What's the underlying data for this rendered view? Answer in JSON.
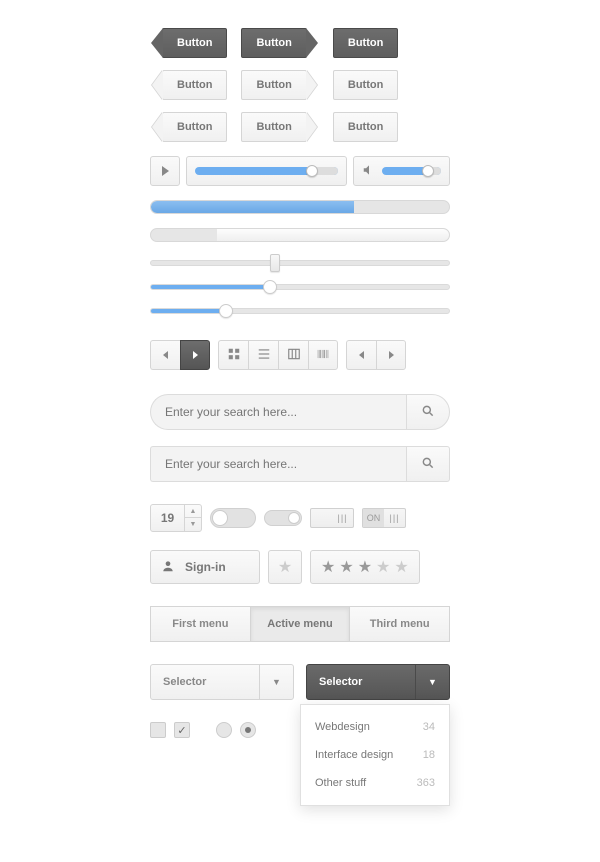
{
  "buttons": {
    "row1": [
      "Button",
      "Button",
      "Button"
    ],
    "row2": [
      "Button",
      "Button",
      "Button"
    ],
    "row3": [
      "Button",
      "Button",
      "Button"
    ]
  },
  "player": {
    "progress_pct": 82,
    "volume_pct": 78
  },
  "progress": {
    "blue_pct": 68,
    "gray_pct": 22
  },
  "sliders": {
    "s1_pct": 40,
    "s2_pct": 40,
    "s3_pct": 25
  },
  "search": {
    "placeholder": "Enter your search here..."
  },
  "stepper": {
    "value": "19"
  },
  "toggle_rect": {
    "on_label": "ON"
  },
  "signin": {
    "label": "Sign-in"
  },
  "rating": {
    "value": 3,
    "max": 5
  },
  "tabs": [
    "First menu",
    "Active menu",
    "Third menu"
  ],
  "tabs_active_index": 1,
  "selectors": {
    "light_label": "Selector",
    "dark_label": "Selector"
  },
  "dropdown": [
    {
      "label": "Webdesign",
      "count": 34
    },
    {
      "label": "Interface design",
      "count": 18
    },
    {
      "label": "Other stuff",
      "count": 363
    }
  ],
  "checkboxes": {
    "unchecked": false,
    "checked": true
  },
  "radios": {
    "off": false,
    "on": true
  }
}
